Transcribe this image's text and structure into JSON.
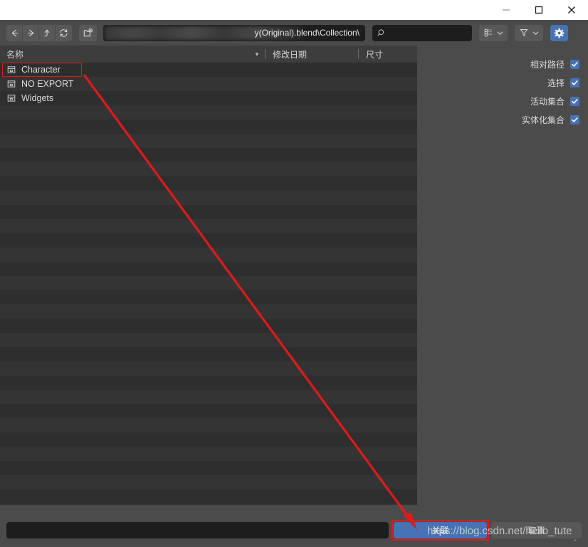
{
  "window": {
    "minimize_label": "—",
    "maximize_label": "□",
    "close_label": "✕"
  },
  "toolbar": {
    "nav": [
      {
        "name": "back",
        "icon": "arrow-left-icon"
      },
      {
        "name": "forward",
        "icon": "arrow-right-icon"
      },
      {
        "name": "parent",
        "icon": "arrow-up-icon"
      },
      {
        "name": "refresh",
        "icon": "refresh-icon"
      }
    ],
    "new_folder_icon": "new-folder-icon",
    "path_value": "y(Original).blend\\Collection\\",
    "path_redacted": true,
    "search_placeholder": "",
    "search_icon": "search-icon",
    "display_mode_icon": "display-mode-icon",
    "display_mode_caret": "chevron-down-icon",
    "filter_icon": "filter-icon",
    "filter_caret": "chevron-down-icon",
    "settings_icon": "gear-icon"
  },
  "filelist": {
    "columns": {
      "name": "名称",
      "date_modified": "修改日期",
      "size": "尺寸",
      "sort_indicator": "▼"
    },
    "items": [
      {
        "label": "Character",
        "icon": "collection-icon",
        "selected": true,
        "date": "",
        "size": ""
      },
      {
        "label": "NO EXPORT",
        "icon": "collection-icon",
        "selected": false,
        "date": "",
        "size": ""
      },
      {
        "label": "Widgets",
        "icon": "collection-icon",
        "selected": false,
        "date": "",
        "size": ""
      }
    ],
    "empty_row_count": 29
  },
  "options": {
    "items": [
      {
        "label": "相对路径",
        "checked": true
      },
      {
        "label": "选择",
        "checked": true
      },
      {
        "label": "活动集合",
        "checked": true
      },
      {
        "label": "实体化集合",
        "checked": true
      }
    ]
  },
  "footer": {
    "filename_value": "",
    "confirm_label": "关联",
    "cancel_label": "取消",
    "resize_grip": "⌃"
  },
  "overlay": {
    "watermark_text": "https://blog.csdn.net/hello_tute",
    "annotation_color": "#e01a1a"
  },
  "colors": {
    "accent": "#4772b3",
    "panel": "#4b4b4b",
    "list_bg": "#2b2b2b",
    "row_odd": "#2e2e2e",
    "row_even": "#343434",
    "field": "#1d1d1d",
    "annotation": "#e01a1a"
  }
}
